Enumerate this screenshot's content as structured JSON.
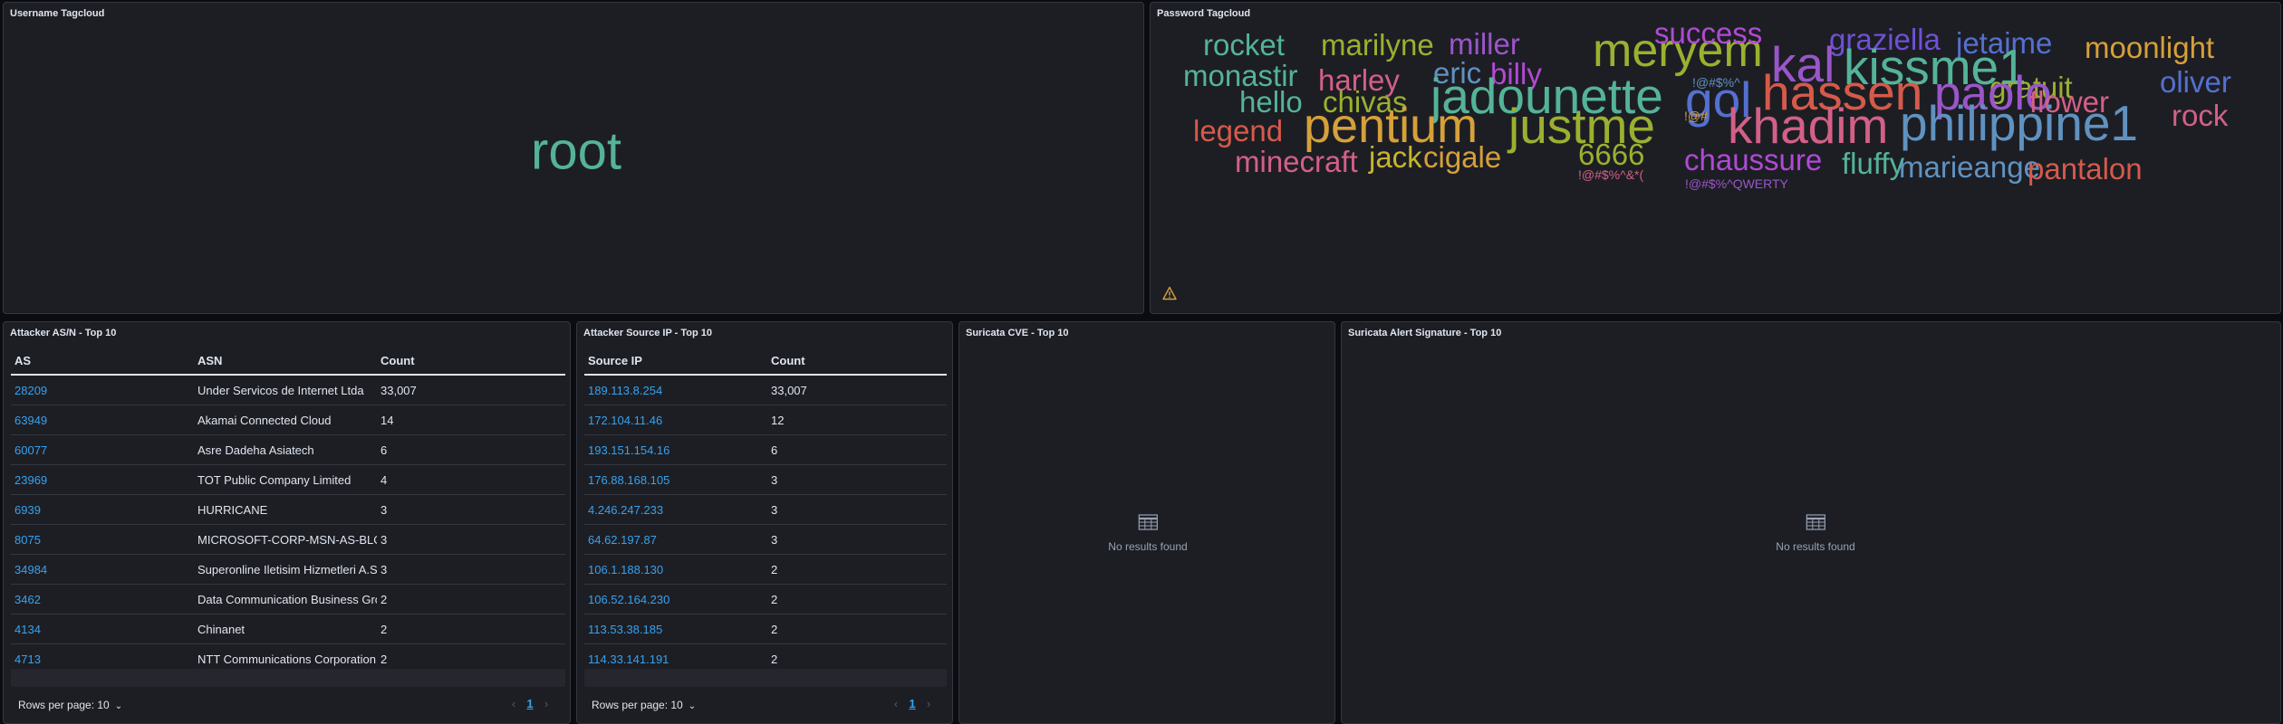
{
  "username_panel": {
    "title": "Username Tagcloud",
    "word": "root",
    "word_color": "#54b399"
  },
  "password_panel": {
    "title": "Password Tagcloud",
    "warning_icon": "warning-icon",
    "words": [
      {
        "text": "rocket",
        "color": "#54b399"
      },
      {
        "text": "marilyne",
        "color": "#9bb030"
      },
      {
        "text": "miller",
        "color": "#9a56c9"
      },
      {
        "text": "meryem",
        "color": "#9bb030"
      },
      {
        "text": "success",
        "color": "#b04ad4"
      },
      {
        "text": "graziella",
        "color": "#7050d6"
      },
      {
        "text": "jetaime",
        "color": "#5470d0"
      },
      {
        "text": "moonlight",
        "color": "#d6a03a"
      },
      {
        "text": "monastir",
        "color": "#54b399"
      },
      {
        "text": "harley",
        "color": "#d36086"
      },
      {
        "text": "eric",
        "color": "#6092c0"
      },
      {
        "text": "billy",
        "color": "#b04ad4"
      },
      {
        "text": "!@#$%^",
        "color": "#6092c0"
      },
      {
        "text": "kal",
        "color": "#9a56c9"
      },
      {
        "text": "kissme1",
        "color": "#54b399"
      },
      {
        "text": "gratuit",
        "color": "#9bb030"
      },
      {
        "text": "oliver",
        "color": "#5470d0"
      },
      {
        "text": "hello",
        "color": "#54b399"
      },
      {
        "text": "chivas",
        "color": "#9bb030"
      },
      {
        "text": "jadounette",
        "color": "#54b399"
      },
      {
        "text": "gol",
        "color": "#5470d0"
      },
      {
        "text": "hassen",
        "color": "#d65a4a"
      },
      {
        "text": "paolo",
        "color": "#9a56c9"
      },
      {
        "text": "flower",
        "color": "#d36086"
      },
      {
        "text": "rock",
        "color": "#d36086"
      },
      {
        "text": "legend",
        "color": "#d65a4a"
      },
      {
        "text": "pentium",
        "color": "#d6a03a"
      },
      {
        "text": "justme",
        "color": "#9bb030"
      },
      {
        "text": "!@#",
        "color": "#d6a03a"
      },
      {
        "text": "khadim",
        "color": "#d36086"
      },
      {
        "text": "philippine1",
        "color": "#6092c0"
      },
      {
        "text": "minecraft",
        "color": "#d36086"
      },
      {
        "text": "jack",
        "color": "#c8b52c"
      },
      {
        "text": "cigale",
        "color": "#d6a03a"
      },
      {
        "text": "6666",
        "color": "#9bb030"
      },
      {
        "text": "chaussure",
        "color": "#b04ad4"
      },
      {
        "text": "fluffy",
        "color": "#54b399"
      },
      {
        "text": "marieange",
        "color": "#6092c0"
      },
      {
        "text": "pantalon",
        "color": "#d65a4a"
      },
      {
        "text": "!@#$%^&*(",
        "color": "#d36086"
      },
      {
        "text": "!@#$%^QWERTY",
        "color": "#9a56c9"
      }
    ]
  },
  "asn_panel": {
    "title": "Attacker AS/N - Top 10",
    "columns": [
      "AS",
      "ASN",
      "Count"
    ],
    "rows": [
      [
        "28209",
        "Under Servicos de Internet Ltda",
        "33,007"
      ],
      [
        "63949",
        "Akamai Connected Cloud",
        "14"
      ],
      [
        "60077",
        "Asre Dadeha Asiatech",
        "6"
      ],
      [
        "23969",
        "TOT Public Company Limited",
        "4"
      ],
      [
        "6939",
        "HURRICANE",
        "3"
      ],
      [
        "8075",
        "MICROSOFT-CORP-MSN-AS-BLOCK",
        "3"
      ],
      [
        "34984",
        "Superonline Iletisim Hizmetleri A.S.",
        "3"
      ],
      [
        "3462",
        "Data Communication Business Group",
        "2"
      ],
      [
        "4134",
        "Chinanet",
        "2"
      ],
      [
        "4713",
        "NTT Communications Corporation",
        "2"
      ]
    ],
    "rows_per_page_label": "Rows per page: 10",
    "current_page": "1"
  },
  "ip_panel": {
    "title": "Attacker Source IP - Top 10",
    "columns": [
      "Source IP",
      "Count"
    ],
    "rows": [
      [
        "189.113.8.254",
        "33,007"
      ],
      [
        "172.104.11.46",
        "12"
      ],
      [
        "193.151.154.16",
        "6"
      ],
      [
        "176.88.168.105",
        "3"
      ],
      [
        "4.246.247.233",
        "3"
      ],
      [
        "64.62.197.87",
        "3"
      ],
      [
        "106.1.188.130",
        "2"
      ],
      [
        "106.52.164.230",
        "2"
      ],
      [
        "113.53.38.185",
        "2"
      ],
      [
        "114.33.141.191",
        "2"
      ]
    ],
    "rows_per_page_label": "Rows per page: 10",
    "current_page": "1"
  },
  "cve_panel": {
    "title": "Suricata CVE - Top 10",
    "empty_icon": "table-icon",
    "empty_text": "No results found"
  },
  "signature_panel": {
    "title": "Suricata Alert Signature - Top 10",
    "empty_icon": "table-icon",
    "empty_text": "No results found"
  }
}
